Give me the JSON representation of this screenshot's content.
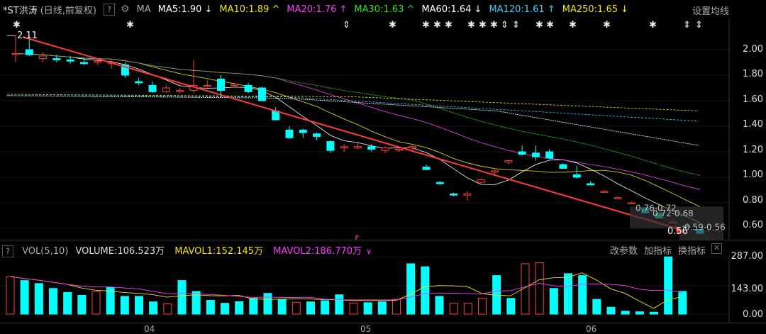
{
  "header": {
    "stock_name": "*ST洪涛",
    "period": "(日线,前复权)",
    "help": "?",
    "ma_label": "MA",
    "ma_items": [
      {
        "label": "MA5:1.90",
        "arrow": "↓",
        "color": "#ffffff"
      },
      {
        "label": "MA10:1.89",
        "arrow": "^",
        "color": "#f2e60d"
      },
      {
        "label": "MA20:1.76",
        "arrow": "↑",
        "color": "#ff39ff"
      },
      {
        "label": "MA30:1.63",
        "arrow": "^",
        "color": "#22e622"
      },
      {
        "label": "MA60:1.64",
        "arrow": "↓",
        "color": "#ffffff"
      },
      {
        "label": "MA120:1.61",
        "arrow": "↑",
        "color": "#2bd6ff"
      },
      {
        "label": "MA250:1.65",
        "arrow": "↓",
        "color": "#f2e60d"
      }
    ],
    "settings": "设置均线"
  },
  "price_axis": [
    "2.00",
    "1.80",
    "1.60",
    "1.40",
    "1.20",
    "1.00",
    "0.80",
    "0.60"
  ],
  "annotations": {
    "high": "2.11",
    "low": "0.56",
    "range1": "0.76-0.72",
    "range2": "0.72-0.68",
    "range3": "0.59-0.56",
    "marker": "ε"
  },
  "volume_header": {
    "help": "?",
    "label": "VOL(5,10)",
    "volume": "VOLUME:106.523万",
    "mavol1": "MAVOL1:152.145万",
    "mavol2": "MAVOL2:186.770万",
    "mavol2_arrow": "∨"
  },
  "volume_buttons": {
    "params": "改参数",
    "add": "加指标",
    "switch": "换指标"
  },
  "volume_axis": [
    "287.00",
    "143.00",
    "0.00"
  ],
  "x_axis": [
    "04",
    "05",
    "06"
  ],
  "colors": {
    "up": "#ff3c3c",
    "down": "#00ffff",
    "trend": "#ff3a3a"
  },
  "chart_data": {
    "type": "candlestick",
    "price_ylim": [
      0.55,
      2.15
    ],
    "volume_ylim": [
      0,
      287
    ],
    "candles": [
      {
        "o": 1.97,
        "h": 2.11,
        "l": 1.9,
        "c": 1.97
      },
      {
        "o": 2.0,
        "h": 2.11,
        "l": 1.95,
        "c": 1.96
      },
      {
        "o": 1.93,
        "h": 1.98,
        "l": 1.9,
        "c": 1.95
      },
      {
        "o": 1.93,
        "h": 1.96,
        "l": 1.9,
        "c": 1.92
      },
      {
        "o": 1.92,
        "h": 1.95,
        "l": 1.89,
        "c": 1.91
      },
      {
        "o": 1.9,
        "h": 1.94,
        "l": 1.88,
        "c": 1.89
      },
      {
        "o": 1.9,
        "h": 1.93,
        "l": 1.88,
        "c": 1.91
      },
      {
        "o": 1.89,
        "h": 1.92,
        "l": 1.85,
        "c": 1.9
      },
      {
        "o": 1.88,
        "h": 1.9,
        "l": 1.78,
        "c": 1.8
      },
      {
        "o": 1.75,
        "h": 1.78,
        "l": 1.72,
        "c": 1.74
      },
      {
        "o": 1.72,
        "h": 1.75,
        "l": 1.66,
        "c": 1.67
      },
      {
        "o": 1.67,
        "h": 1.72,
        "l": 1.66,
        "c": 1.7
      },
      {
        "o": 1.68,
        "h": 1.7,
        "l": 1.66,
        "c": 1.68
      },
      {
        "o": 1.68,
        "h": 1.92,
        "l": 1.66,
        "c": 1.72
      },
      {
        "o": 1.72,
        "h": 1.76,
        "l": 1.7,
        "c": 1.72
      },
      {
        "o": 1.77,
        "h": 1.8,
        "l": 1.63,
        "c": 1.68
      },
      {
        "o": 1.72,
        "h": 1.74,
        "l": 1.7,
        "c": 1.73
      },
      {
        "o": 1.72,
        "h": 1.74,
        "l": 1.66,
        "c": 1.67
      },
      {
        "o": 1.7,
        "h": 1.71,
        "l": 1.6,
        "c": 1.6
      },
      {
        "o": 1.52,
        "h": 1.55,
        "l": 1.45,
        "c": 1.45
      },
      {
        "o": 1.37,
        "h": 1.4,
        "l": 1.3,
        "c": 1.31
      },
      {
        "o": 1.37,
        "h": 1.38,
        "l": 1.31,
        "c": 1.35
      },
      {
        "o": 1.34,
        "h": 1.35,
        "l": 1.29,
        "c": 1.32
      },
      {
        "o": 1.28,
        "h": 1.29,
        "l": 1.19,
        "c": 1.21
      },
      {
        "o": 1.23,
        "h": 1.26,
        "l": 1.2,
        "c": 1.24
      },
      {
        "o": 1.23,
        "h": 1.28,
        "l": 1.22,
        "c": 1.24
      },
      {
        "o": 1.24,
        "h": 1.26,
        "l": 1.2,
        "c": 1.22
      },
      {
        "o": 1.21,
        "h": 1.24,
        "l": 1.19,
        "c": 1.23
      },
      {
        "o": 1.22,
        "h": 1.23,
        "l": 1.2,
        "c": 1.22
      },
      {
        "o": 1.23,
        "h": 1.25,
        "l": 1.21,
        "c": 1.24
      },
      {
        "o": 1.08,
        "h": 1.1,
        "l": 1.06,
        "c": 1.06
      },
      {
        "o": 0.96,
        "h": 0.97,
        "l": 0.94,
        "c": 0.95
      },
      {
        "o": 0.87,
        "h": 0.88,
        "l": 0.85,
        "c": 0.86
      },
      {
        "o": 0.86,
        "h": 0.89,
        "l": 0.82,
        "c": 0.87
      },
      {
        "o": 0.96,
        "h": 0.99,
        "l": 0.95,
        "c": 0.98
      },
      {
        "o": 1.04,
        "h": 1.06,
        "l": 1.02,
        "c": 1.05
      },
      {
        "o": 1.12,
        "h": 1.14,
        "l": 1.1,
        "c": 1.13
      },
      {
        "o": 1.2,
        "h": 1.25,
        "l": 1.17,
        "c": 1.18
      },
      {
        "o": 1.19,
        "h": 1.25,
        "l": 1.13,
        "c": 1.16
      },
      {
        "o": 1.2,
        "h": 1.22,
        "l": 1.14,
        "c": 1.15
      },
      {
        "o": 1.1,
        "h": 1.11,
        "l": 1.07,
        "c": 1.07
      },
      {
        "o": 1.02,
        "h": 1.09,
        "l": 0.99,
        "c": 1.0
      },
      {
        "o": 0.95,
        "h": 0.97,
        "l": 0.94,
        "c": 0.94
      },
      {
        "o": 0.89,
        "h": 0.9,
        "l": 0.88,
        "c": 0.89
      },
      {
        "o": 0.84,
        "h": 0.85,
        "l": 0.83,
        "c": 0.84
      },
      {
        "o": 0.8,
        "h": 0.81,
        "l": 0.79,
        "c": 0.8
      },
      {
        "o": 0.76,
        "h": 0.76,
        "l": 0.72,
        "c": 0.72
      },
      {
        "o": 0.72,
        "h": 0.72,
        "l": 0.68,
        "c": 0.68
      },
      {
        "o": 0.65,
        "h": 0.66,
        "l": 0.64,
        "c": 0.65
      },
      {
        "o": 0.62,
        "h": 0.62,
        "l": 0.61,
        "c": 0.61
      },
      {
        "o": 0.59,
        "h": 0.59,
        "l": 0.56,
        "c": 0.56
      }
    ],
    "volumes": [
      {
        "v": 190,
        "up": true
      },
      {
        "v": 170,
        "up": false
      },
      {
        "v": 155,
        "up": false
      },
      {
        "v": 130,
        "up": false
      },
      {
        "v": 110,
        "up": false
      },
      {
        "v": 95,
        "up": false
      },
      {
        "v": 115,
        "up": true
      },
      {
        "v": 135,
        "up": false
      },
      {
        "v": 90,
        "up": false
      },
      {
        "v": 90,
        "up": false
      },
      {
        "v": 62,
        "up": false
      },
      {
        "v": 52,
        "up": true
      },
      {
        "v": 170,
        "up": false
      },
      {
        "v": 115,
        "up": false
      },
      {
        "v": 70,
        "up": false
      },
      {
        "v": 55,
        "up": false
      },
      {
        "v": 63,
        "up": false
      },
      {
        "v": 80,
        "up": false
      },
      {
        "v": 105,
        "up": false
      },
      {
        "v": 75,
        "up": false
      },
      {
        "v": 60,
        "up": true
      },
      {
        "v": 62,
        "up": false
      },
      {
        "v": 68,
        "up": false
      },
      {
        "v": 98,
        "up": false
      },
      {
        "v": 56,
        "up": true
      },
      {
        "v": 58,
        "up": false
      },
      {
        "v": 62,
        "up": false
      },
      {
        "v": 75,
        "up": true
      },
      {
        "v": 255,
        "up": false
      },
      {
        "v": 240,
        "up": false
      },
      {
        "v": 90,
        "up": false
      },
      {
        "v": 55,
        "up": true
      },
      {
        "v": 55,
        "up": true
      },
      {
        "v": 80,
        "up": true
      },
      {
        "v": 195,
        "up": false
      },
      {
        "v": 80,
        "up": false
      },
      {
        "v": 255,
        "up": true
      },
      {
        "v": 260,
        "up": true
      },
      {
        "v": 130,
        "up": false
      },
      {
        "v": 205,
        "up": false
      },
      {
        "v": 195,
        "up": false
      },
      {
        "v": 75,
        "up": false
      },
      {
        "v": 35,
        "up": false
      },
      {
        "v": 15,
        "up": false
      },
      {
        "v": 12,
        "up": false
      },
      {
        "v": 10,
        "up": false
      },
      {
        "v": 290,
        "up": false
      },
      {
        "v": 115,
        "up": false
      }
    ]
  }
}
